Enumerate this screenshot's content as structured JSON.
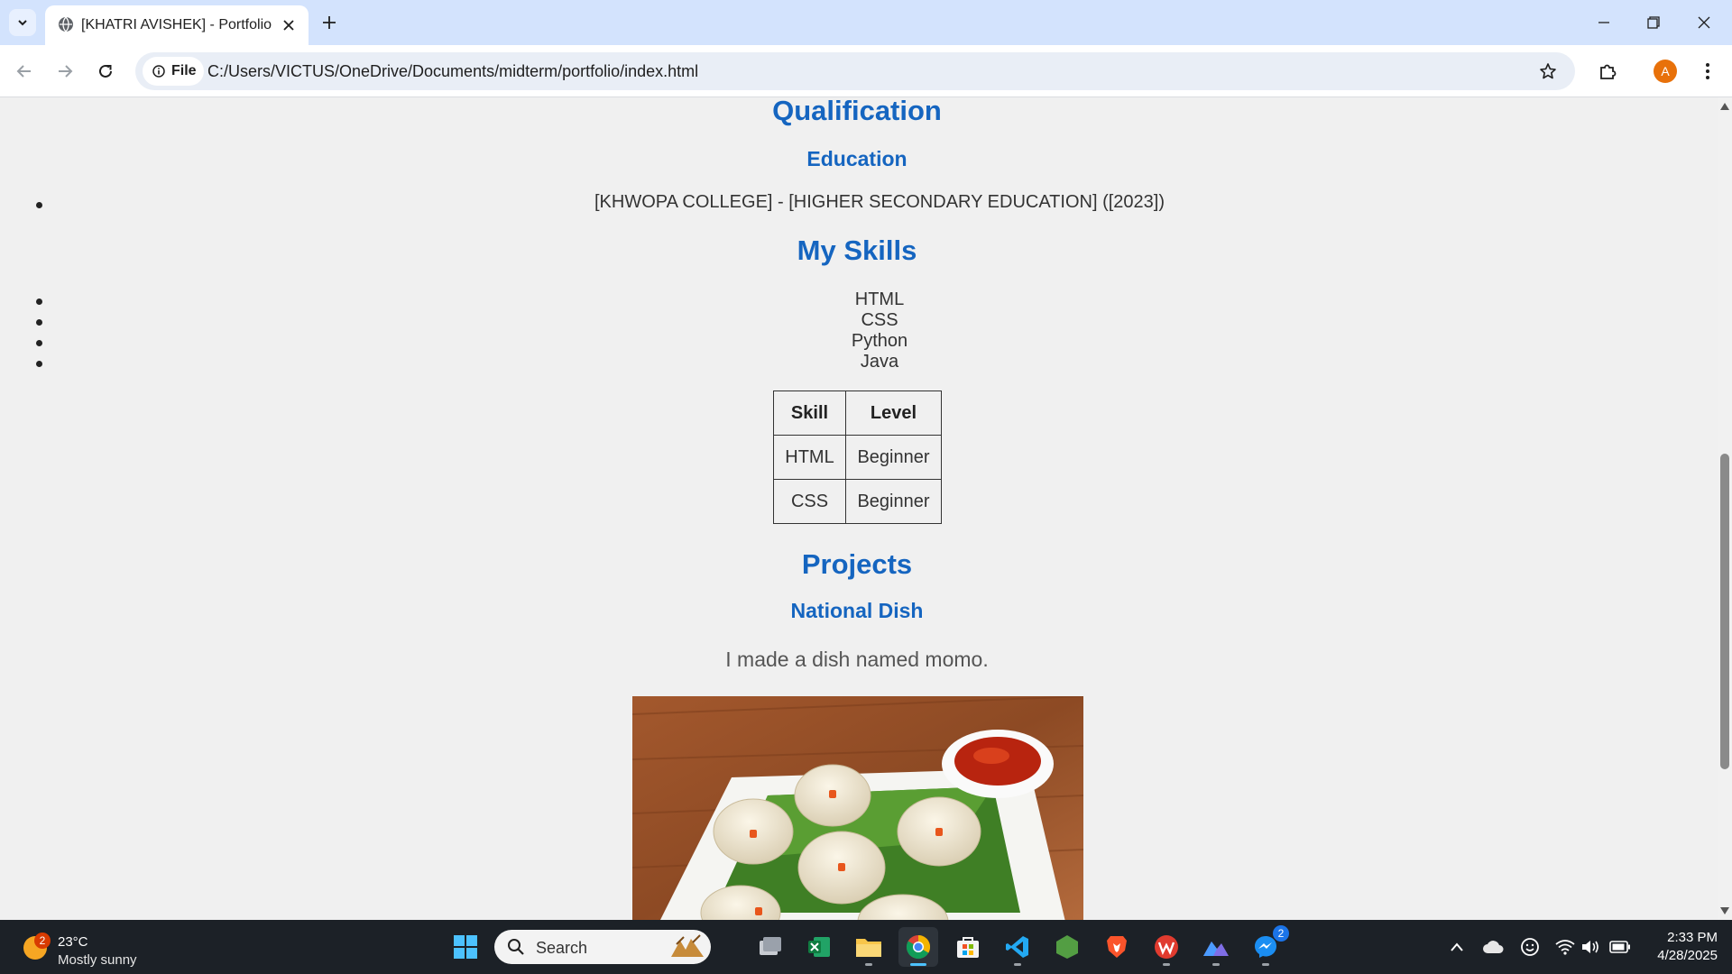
{
  "browser": {
    "tab_title": "[KHATRI AVISHEK] - Portfolio",
    "site_chip": "File",
    "url": "C:/Users/VICTUS/OneDrive/Documents/midterm/portfolio/index.html",
    "profile_initial": "A"
  },
  "page": {
    "qualification_heading": "Qualification",
    "education_heading": "Education",
    "education_item": "[KHWOPA COLLEGE] - [HIGHER SECONDARY EDUCATION] ([2023])",
    "skills_heading": "My Skills",
    "skills": [
      "HTML",
      "CSS",
      "Python",
      "Java"
    ],
    "skill_table": {
      "headers": [
        "Skill",
        "Level"
      ],
      "rows": [
        [
          "HTML",
          "Beginner"
        ],
        [
          "CSS",
          "Beginner"
        ]
      ]
    },
    "projects_heading": "Projects",
    "project_title": "National Dish",
    "project_desc": "I made a dish named momo."
  },
  "taskbar": {
    "weather_temp": "23°C",
    "weather_cond": "Mostly sunny",
    "weather_badge": "2",
    "search_label": "Search",
    "messenger_badge": "2",
    "time": "2:33 PM",
    "date": "4/28/2025"
  }
}
